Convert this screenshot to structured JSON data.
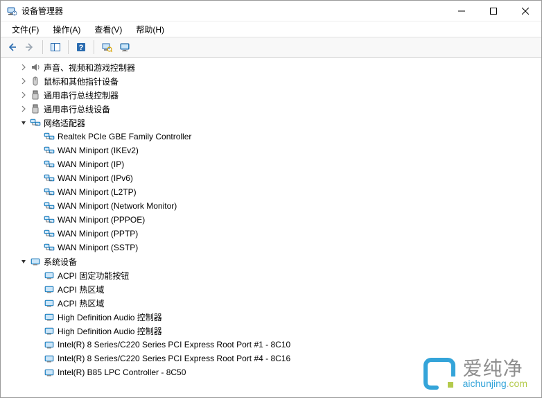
{
  "window": {
    "title": "设备管理器"
  },
  "menu": {
    "file": "文件(F)",
    "action": "操作(A)",
    "view": "查看(V)",
    "help": "帮助(H)"
  },
  "toolbar_icons": {
    "back": "back-icon",
    "forward": "forward-icon",
    "show_hide": "show-hide-tree-icon",
    "help": "help-icon",
    "scan": "scan-hardware-icon",
    "monitor": "monitor-icon"
  },
  "tree": [
    {
      "expand": "collapsed",
      "icon": "sound",
      "label": "声音、视频和游戏控制器",
      "children": []
    },
    {
      "expand": "collapsed",
      "icon": "mouse",
      "label": "鼠标和其他指针设备",
      "children": []
    },
    {
      "expand": "collapsed",
      "icon": "usb",
      "label": "通用串行总线控制器",
      "children": []
    },
    {
      "expand": "collapsed",
      "icon": "usb",
      "label": "通用串行总线设备",
      "children": []
    },
    {
      "expand": "expanded",
      "icon": "network",
      "label": "网络适配器",
      "children": [
        {
          "icon": "network",
          "label": "Realtek PCIe GBE Family Controller"
        },
        {
          "icon": "network",
          "label": "WAN Miniport (IKEv2)"
        },
        {
          "icon": "network",
          "label": "WAN Miniport (IP)"
        },
        {
          "icon": "network",
          "label": "WAN Miniport (IPv6)"
        },
        {
          "icon": "network",
          "label": "WAN Miniport (L2TP)"
        },
        {
          "icon": "network",
          "label": "WAN Miniport (Network Monitor)"
        },
        {
          "icon": "network",
          "label": "WAN Miniport (PPPOE)"
        },
        {
          "icon": "network",
          "label": "WAN Miniport (PPTP)"
        },
        {
          "icon": "network",
          "label": "WAN Miniport (SSTP)"
        }
      ]
    },
    {
      "expand": "expanded",
      "icon": "system",
      "label": "系统设备",
      "children": [
        {
          "icon": "system",
          "label": "ACPI 固定功能按钮"
        },
        {
          "icon": "system",
          "label": "ACPI 热区域"
        },
        {
          "icon": "system",
          "label": "ACPI 热区域"
        },
        {
          "icon": "system",
          "label": "High Definition Audio 控制器"
        },
        {
          "icon": "system",
          "label": "High Definition Audio 控制器"
        },
        {
          "icon": "system",
          "label": "Intel(R) 8 Series/C220 Series PCI Express Root Port #1 - 8C10"
        },
        {
          "icon": "system",
          "label": "Intel(R) 8 Series/C220 Series PCI Express Root Port #4 - 8C16"
        },
        {
          "icon": "system",
          "label": "Intel(R) B85 LPC Controller - 8C50"
        }
      ]
    }
  ],
  "watermark": {
    "cn": "爱纯净",
    "en_1": "aichunjing",
    "en_2": ".",
    "en_3": "com"
  }
}
